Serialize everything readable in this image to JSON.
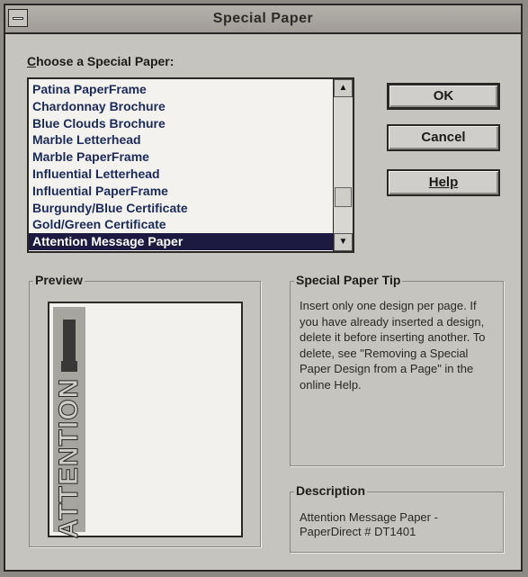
{
  "window": {
    "title": "Special Paper"
  },
  "chooser": {
    "label_hotkey": "C",
    "label_rest": "hoose a Special Paper:",
    "items": [
      "Patina PaperFrame",
      "Chardonnay Brochure",
      "Blue Clouds Brochure",
      "Marble Letterhead",
      "Marble PaperFrame",
      "Influential Letterhead",
      "Influential PaperFrame",
      "Burgundy/Blue Certificate",
      "Gold/Green Certificate",
      "Attention Message Paper"
    ],
    "selected_index": 9
  },
  "buttons": {
    "ok": "OK",
    "cancel": "Cancel",
    "help": "Help"
  },
  "preview": {
    "label": "Preview",
    "paper_text": "ATTENTION"
  },
  "tip": {
    "label": "Special Paper Tip",
    "text": "Insert only one design per page. If you have already inserted a design, delete it before inserting another. To delete, see \"Removing a Special Paper Design from a Page\" in the online Help."
  },
  "description": {
    "label": "Description",
    "text": "Attention Message Paper - PaperDirect # DT1401"
  },
  "colors": {
    "selection": "#1c1a40",
    "dialog_bg": "#c6c4bf"
  }
}
